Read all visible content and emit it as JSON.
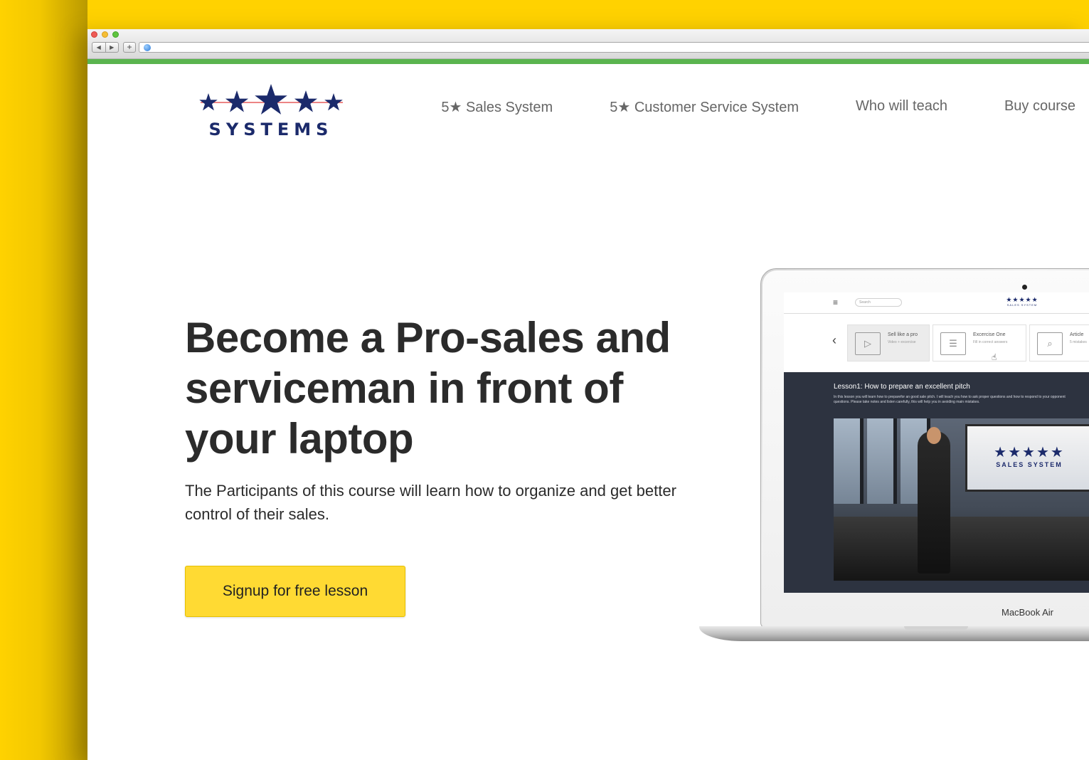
{
  "brand": {
    "logo_text": "SYSTEMS",
    "logo_color": "#1b2a6b",
    "accent_red": "#e03a3a"
  },
  "colors": {
    "background_yellow": "#FFD200",
    "browser_accent_green": "#5ab44f",
    "cta_yellow": "#FFDA33"
  },
  "browser": {
    "back_glyph": "◀",
    "forward_glyph": "▶",
    "new_tab_glyph": "+",
    "url_icon": "globe-icon"
  },
  "nav": {
    "items": [
      {
        "label": "5★ Sales System"
      },
      {
        "label": "5★ Customer Service System"
      },
      {
        "label": "Who will teach"
      },
      {
        "label": "Buy course"
      }
    ]
  },
  "hero": {
    "title": "Become a Pro-sales and serviceman in front of your laptop",
    "subtitle": "The Participants of this course will learn how to organize and get better control of their sales.",
    "cta_label": "Signup for free lesson"
  },
  "laptop": {
    "brand_label": "MacBook Air",
    "screen": {
      "menu_icon": "≡",
      "search_placeholder": "Search",
      "logo_stars": "★★★★★",
      "logo_text": "SALES SYSTEM",
      "back_chevron": "‹",
      "cards": [
        {
          "title": "Sell like a pro",
          "subtitle": "Video + excercise",
          "icon": "video-icon",
          "glyph": "▷"
        },
        {
          "title": "Excercise One",
          "subtitle": "Fill in correct answers",
          "icon": "book-icon",
          "glyph": "☰"
        },
        {
          "title": "Article",
          "subtitle": "5 mistakes",
          "icon": "search-doc-icon",
          "glyph": "⌕"
        }
      ],
      "cursor_glyph": "☝",
      "lesson_title": "Lesson1: How to prepare an excellent pitch",
      "lesson_description": "In this lesson you will learn how to preparefor an good sale pitch. I will teach you how to ask proper questions and how to respond to your opponent questions. Please take notes and listen carefully, this will help you in avoiding main mistakes.",
      "video_screen_stars": "★★★★★",
      "video_screen_text": "SALES SYSTEM"
    }
  }
}
